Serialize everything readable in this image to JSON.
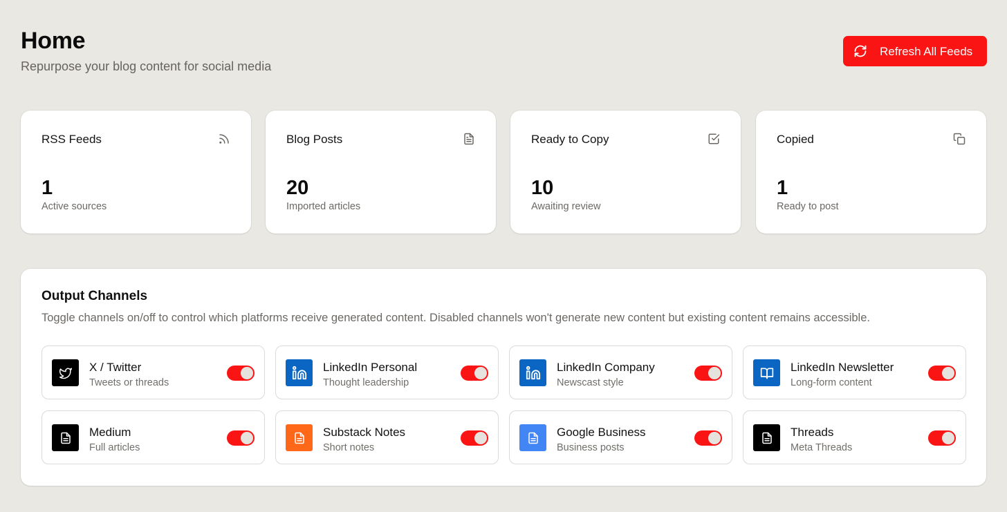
{
  "header": {
    "title": "Home",
    "subtitle": "Repurpose your blog content for social media",
    "refresh_label": "Refresh All Feeds",
    "refresh_icon": "refresh-icon",
    "accent_color": "#fa1414"
  },
  "stats": [
    {
      "title": "RSS Feeds",
      "value": "1",
      "caption": "Active sources",
      "icon": "rss-icon"
    },
    {
      "title": "Blog Posts",
      "value": "20",
      "caption": "Imported articles",
      "icon": "document-icon"
    },
    {
      "title": "Ready to Copy",
      "value": "10",
      "caption": "Awaiting review",
      "icon": "checkbox-icon"
    },
    {
      "title": "Copied",
      "value": "1",
      "caption": "Ready to post",
      "icon": "copy-icon"
    }
  ],
  "channels": {
    "title": "Output Channels",
    "description": "Toggle channels on/off to control which platforms receive generated content. Disabled channels won't generate new content but existing content remains accessible.",
    "items": [
      {
        "name": "X / Twitter",
        "desc": "Tweets or threads",
        "icon": "twitter-bird-icon",
        "color": "#000000",
        "enabled": true
      },
      {
        "name": "LinkedIn Personal",
        "desc": "Thought leadership",
        "icon": "linkedin-icon",
        "color": "#0a66c2",
        "enabled": true
      },
      {
        "name": "LinkedIn Company",
        "desc": "Newscast style",
        "icon": "linkedin-icon",
        "color": "#0a66c2",
        "enabled": true
      },
      {
        "name": "LinkedIn Newsletter",
        "desc": "Long-form content",
        "icon": "book-open-icon",
        "color": "#0a66c2",
        "enabled": true
      },
      {
        "name": "Medium",
        "desc": "Full articles",
        "icon": "document-icon",
        "color": "#000000",
        "enabled": true
      },
      {
        "name": "Substack Notes",
        "desc": "Short notes",
        "icon": "document-icon",
        "color": "#ff6719",
        "enabled": true
      },
      {
        "name": "Google Business",
        "desc": "Business posts",
        "icon": "document-icon",
        "color": "#4285f4",
        "enabled": true
      },
      {
        "name": "Threads",
        "desc": "Meta Threads",
        "icon": "document-icon",
        "color": "#000000",
        "enabled": true
      }
    ]
  }
}
